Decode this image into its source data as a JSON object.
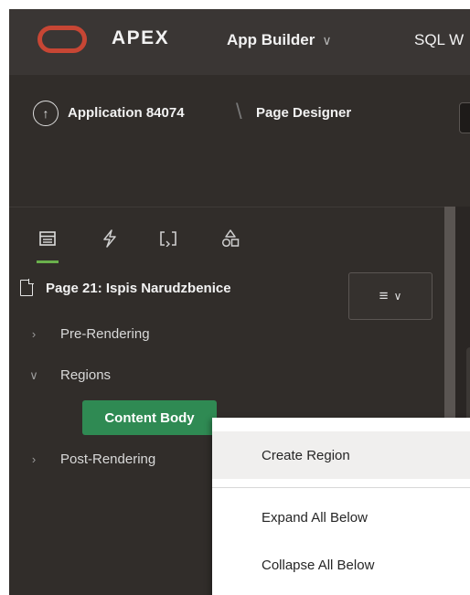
{
  "header": {
    "brand": "APEX",
    "app_builder": "App Builder",
    "sql_workshop": "SQL W",
    "chevron": "∨"
  },
  "breadcrumb": {
    "up_arrow": "↑",
    "application": "Application 84074",
    "separator": "\\",
    "page": "Page Designer"
  },
  "tree_tabs": [
    {
      "icon": "rendering-icon",
      "active": true
    },
    {
      "icon": "dynamic-actions-icon",
      "active": false
    },
    {
      "icon": "processing-icon",
      "active": false
    },
    {
      "icon": "shared-components-icon",
      "active": false
    }
  ],
  "tree": {
    "root": "Page 21: Ispis Narudzbenice",
    "menu_glyph": "≡",
    "menu_chevron": "∨",
    "items": [
      {
        "label": "Pre-Rendering",
        "toggle": "›"
      },
      {
        "label": "Regions",
        "toggle": "∨"
      },
      {
        "label": "Post-Rendering",
        "toggle": "›"
      }
    ],
    "selected_node": "Content Body"
  },
  "context_menu": {
    "items": [
      {
        "label": "Create Region"
      },
      {
        "label": "Expand All Below"
      },
      {
        "label": "Collapse All Below"
      }
    ]
  },
  "colors": {
    "oracle_red": "#c74634",
    "selected_node": "#2f8a53",
    "active_tab": "#6ab04c"
  }
}
